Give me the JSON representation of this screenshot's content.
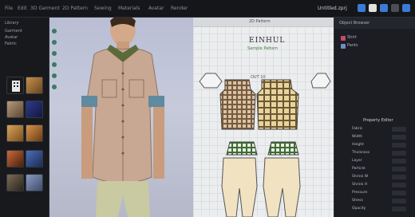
{
  "menubar": {
    "items": [
      "File",
      "Edit",
      "3D Garment",
      "2D Pattern",
      "Sewing",
      "Materials",
      "Avatar",
      "Render"
    ],
    "title": "Untitled.zprj",
    "icon_colors": [
      "#3a7bd5",
      "#e0e0e0",
      "#3a7bd5",
      "#4a4f57",
      "#3a7bd5"
    ]
  },
  "left_panel": {
    "header_label": "Library",
    "sub_labels": [
      "Garment",
      "Avatar",
      "Fabric"
    ]
  },
  "viewport": {
    "tool_icons": [
      "select-icon",
      "move-icon",
      "pin-icon",
      "brush-icon",
      "zoom-icon",
      "rotate-icon"
    ]
  },
  "pattern": {
    "tab_label": "2D Pattern",
    "title": "EINHUL",
    "subtitle": "Sample Pattern",
    "small_note": "OUT 10"
  },
  "right_panel": {
    "header": "Object Browser",
    "tree": [
      "Shirt",
      "Pants"
    ],
    "section_label": "Property Editor",
    "rows": [
      "Fabric",
      "Width",
      "Height",
      "Thickness",
      "Layer",
      "Particle",
      "Shrink W",
      "Shrink H",
      "Pressure",
      "Stress",
      "Opacity"
    ]
  }
}
